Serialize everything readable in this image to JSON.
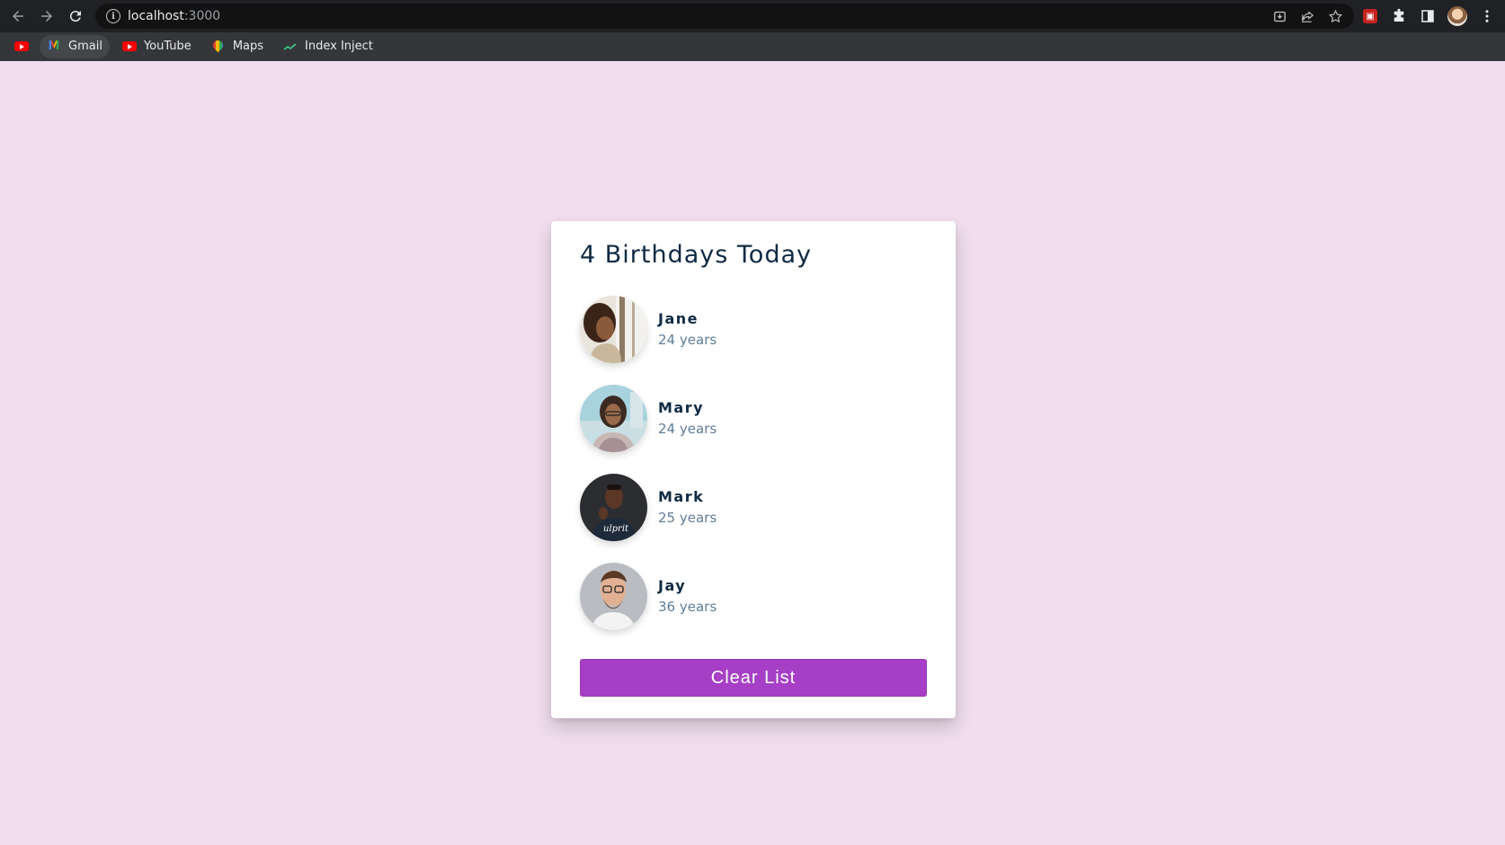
{
  "browser": {
    "url_host": "localhost",
    "url_port": ":3000",
    "bookmarks": [
      {
        "label": ""
      },
      {
        "label": "Gmail"
      },
      {
        "label": "YouTube"
      },
      {
        "label": "Maps"
      },
      {
        "label": "Index Inject"
      }
    ]
  },
  "card": {
    "title": "4 Birthdays Today",
    "people": [
      {
        "name": "Jane",
        "age": "24 years"
      },
      {
        "name": "Mary",
        "age": "24 years"
      },
      {
        "name": "Mark",
        "age": "25 years"
      },
      {
        "name": "Jay",
        "age": "36 years"
      }
    ],
    "clear_label": "Clear List"
  },
  "colors": {
    "page_background": "#f0deee",
    "button": "#a63fc6",
    "title_text": "#102a42",
    "age_text": "#617d98"
  }
}
